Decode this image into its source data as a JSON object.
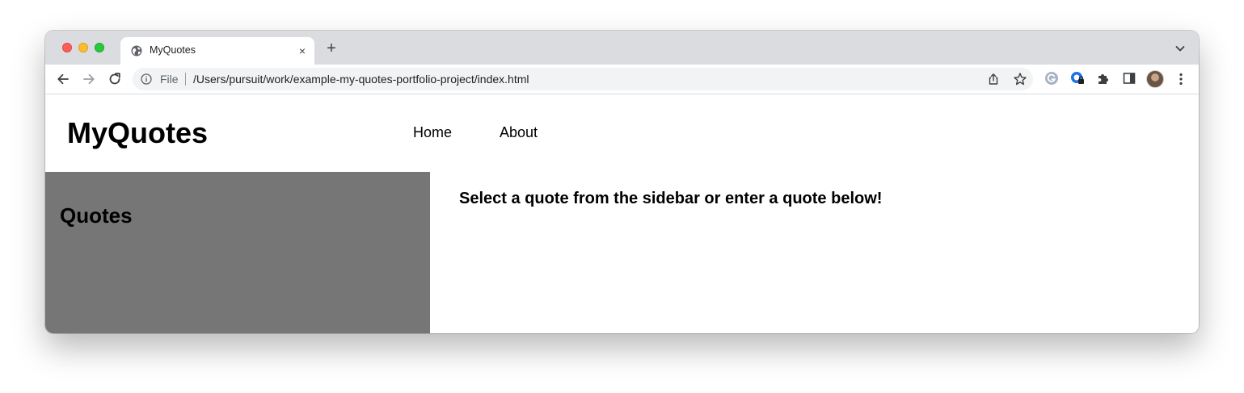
{
  "browser": {
    "tab": {
      "title": "MyQuotes",
      "close_label": "×"
    },
    "new_tab_label": "+",
    "omnibox": {
      "scheme_label": "File",
      "url": "/Users/pursuit/work/example-my-quotes-portfolio-project/index.html"
    },
    "icons": {
      "favicon": "globe-icon",
      "back": "back-arrow-icon",
      "forward": "forward-arrow-icon",
      "reload": "reload-icon",
      "info": "info-icon",
      "share": "share-icon",
      "bookmark": "star-icon",
      "extension_g": "grammarly-icon",
      "extension_lock": "password-manager-icon",
      "extensions": "puzzle-icon",
      "side_panel": "side-panel-icon",
      "menu": "kebab-menu-icon",
      "tab_search": "chevron-down-icon"
    },
    "colors": {
      "tabstrip": "#dadce0",
      "omnibox": "#f1f3f4"
    }
  },
  "site": {
    "brand": "MyQuotes",
    "nav": [
      {
        "label": "Home"
      },
      {
        "label": "About"
      }
    ],
    "sidebar": {
      "title": "Quotes",
      "background": "#767676"
    },
    "main": {
      "heading": "Select a quote from the sidebar or enter a quote below!"
    }
  }
}
